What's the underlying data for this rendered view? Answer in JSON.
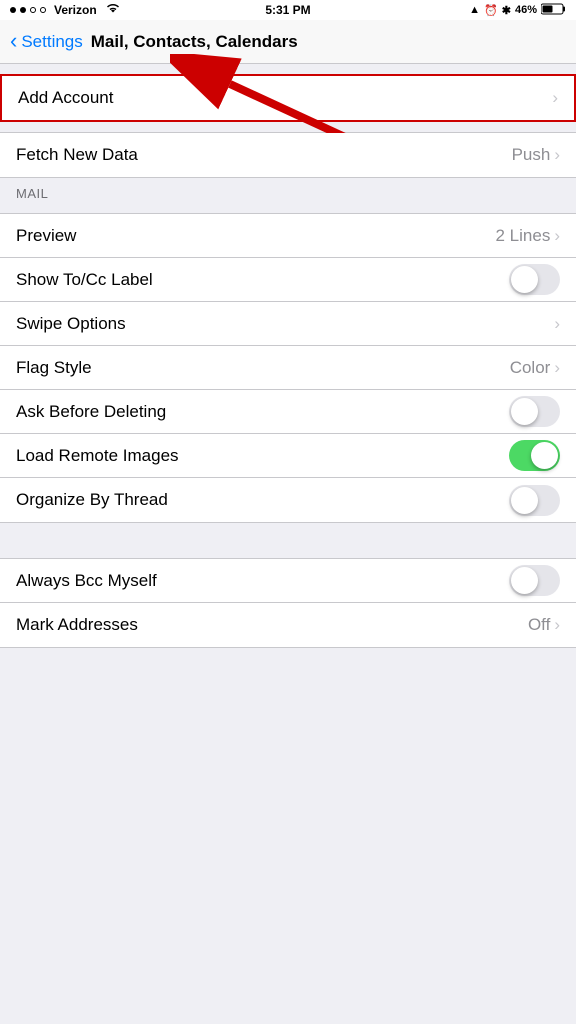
{
  "statusBar": {
    "carrier": "Verizon",
    "time": "5:31 PM",
    "battery": "46%",
    "signal_dots": 2,
    "total_dots": 4
  },
  "navBar": {
    "back_label": "Settings",
    "title": "Mail, Contacts, Calendars"
  },
  "sections": {
    "account": {
      "add_account_label": "Add Account"
    },
    "fetchNewData": {
      "label": "Fetch New Data",
      "value": "Push"
    },
    "mailHeader": "MAIL",
    "mailItems": [
      {
        "label": "Preview",
        "value": "2 Lines",
        "type": "chevron"
      },
      {
        "label": "Show To/Cc Label",
        "value": "",
        "type": "toggle",
        "on": false
      },
      {
        "label": "Swipe Options",
        "value": "",
        "type": "chevron"
      },
      {
        "label": "Flag Style",
        "value": "Color",
        "type": "chevron"
      },
      {
        "label": "Ask Before Deleting",
        "value": "",
        "type": "toggle",
        "on": false
      },
      {
        "label": "Load Remote Images",
        "value": "",
        "type": "toggle",
        "on": true
      },
      {
        "label": "Organize By Thread",
        "value": "",
        "type": "toggle",
        "on": false
      }
    ],
    "bottomItems": [
      {
        "label": "Always Bcc Myself",
        "value": "",
        "type": "toggle",
        "on": false
      },
      {
        "label": "Mark Addresses",
        "value": "Off",
        "type": "chevron"
      }
    ]
  }
}
